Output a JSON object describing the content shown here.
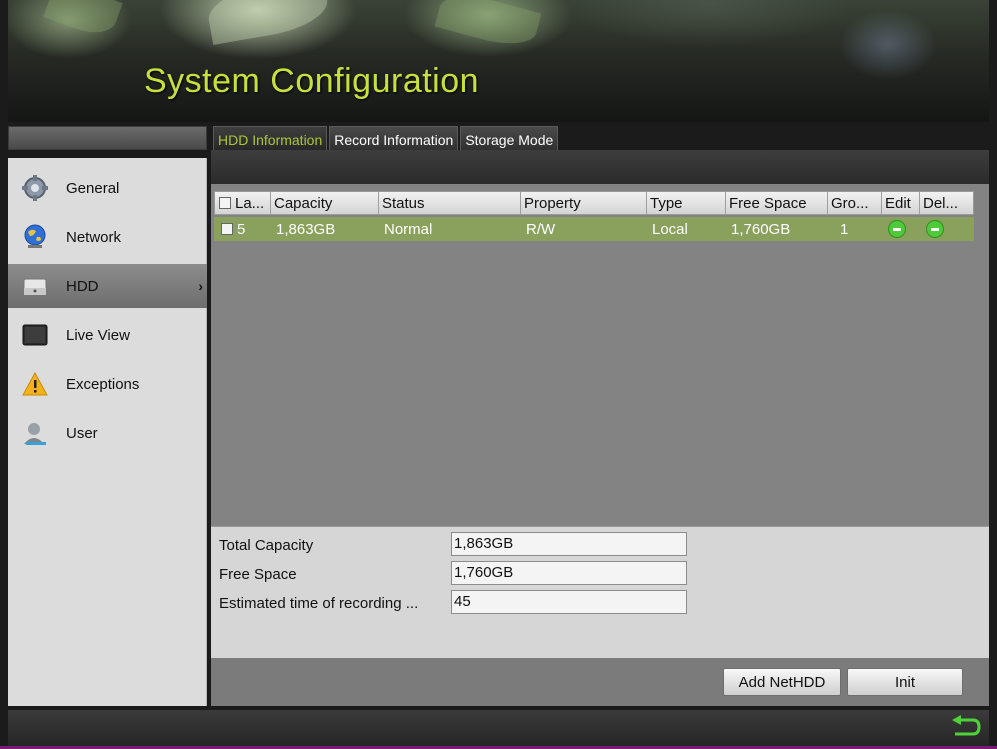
{
  "window": {
    "title": "System Configuration"
  },
  "sidebar": {
    "items": [
      {
        "label": "General",
        "icon": "gear-icon",
        "active": false
      },
      {
        "label": "Network",
        "icon": "globe-icon",
        "active": false
      },
      {
        "label": "HDD",
        "icon": "hdd-icon",
        "active": true,
        "arrow": "›"
      },
      {
        "label": "Live View",
        "icon": "monitor-icon",
        "active": false
      },
      {
        "label": "Exceptions",
        "icon": "warning-icon",
        "active": false
      },
      {
        "label": "User",
        "icon": "user-icon",
        "active": false
      }
    ]
  },
  "tabs": [
    {
      "label": "HDD Information",
      "active": true
    },
    {
      "label": "Record Information",
      "active": false
    },
    {
      "label": "Storage Mode",
      "active": false
    }
  ],
  "table": {
    "columns": [
      "La...",
      "Capacity",
      "Status",
      "Property",
      "Type",
      "Free Space",
      "Gro...",
      "Edit",
      "Del..."
    ],
    "rows": [
      {
        "label": "5",
        "capacity": "1,863GB",
        "status": "Normal",
        "property": "R/W",
        "type": "Local",
        "free_space": "1,760GB",
        "group": "1"
      }
    ]
  },
  "info": {
    "total_capacity_label": "Total Capacity",
    "total_capacity_value": "1,863GB",
    "free_space_label": "Free Space",
    "free_space_value": "1,760GB",
    "est_time_label": "Estimated time of recording ...",
    "est_time_value": "45"
  },
  "buttons": {
    "add_nethdd": "Add NetHDD",
    "init": "Init"
  },
  "colors": {
    "title": "#c8e03c",
    "active_tab": "#a9c63a",
    "selected_row": "#8aa15e",
    "action_green": "#4fc93a"
  }
}
